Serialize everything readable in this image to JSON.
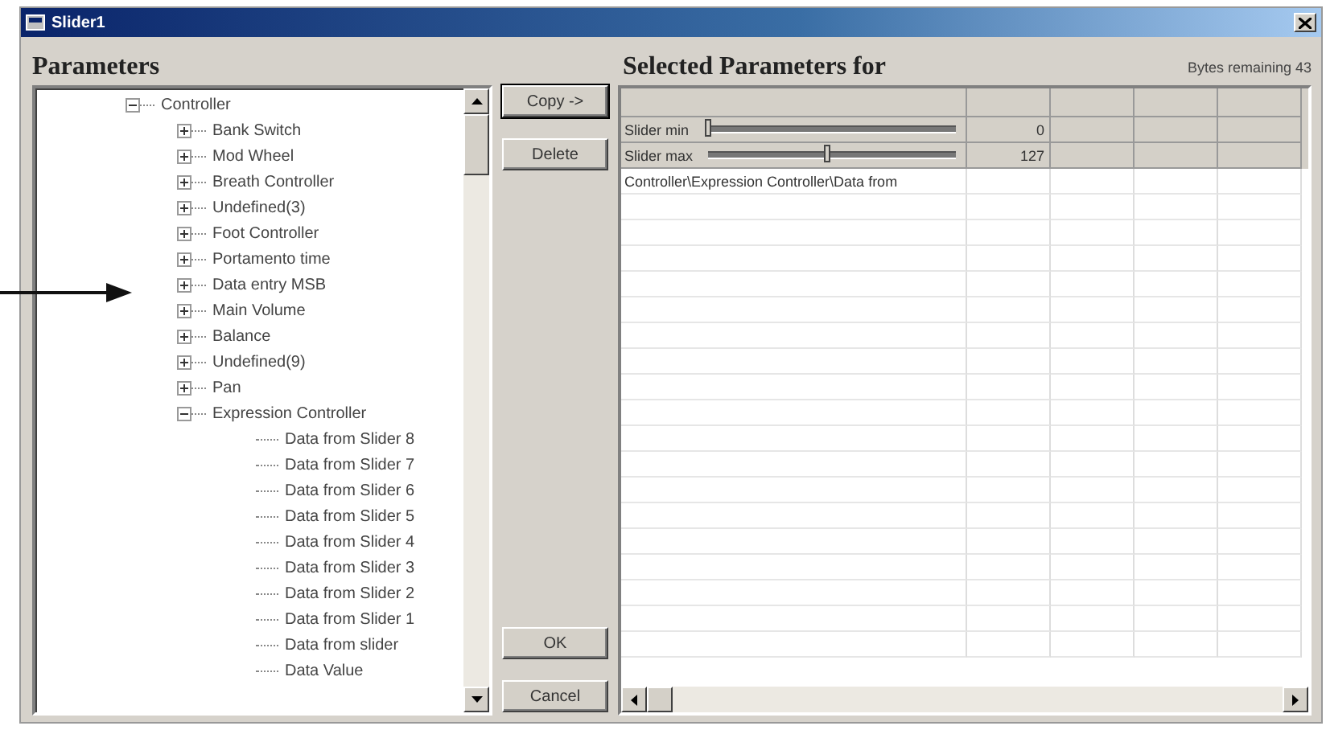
{
  "window": {
    "title": "Slider1"
  },
  "left_heading": "Parameters",
  "tree": [
    {
      "label": "Controller",
      "expanded": true,
      "children": [
        {
          "label": "Bank Switch",
          "expanded": false
        },
        {
          "label": "Mod Wheel",
          "expanded": false
        },
        {
          "label": "Breath Controller",
          "expanded": false
        },
        {
          "label": "Undefined(3)",
          "expanded": false
        },
        {
          "label": "Foot Controller",
          "expanded": false
        },
        {
          "label": "Portamento time",
          "expanded": false
        },
        {
          "label": "Data entry MSB",
          "expanded": false
        },
        {
          "label": "Main Volume",
          "expanded": false
        },
        {
          "label": "Balance",
          "expanded": false
        },
        {
          "label": "Undefined(9)",
          "expanded": false
        },
        {
          "label": "Pan",
          "expanded": false
        },
        {
          "label": "Expression Controller",
          "expanded": true,
          "children": [
            {
              "label": "Data from Slider 8"
            },
            {
              "label": "Data from Slider 7"
            },
            {
              "label": "Data from Slider 6"
            },
            {
              "label": "Data from Slider 5"
            },
            {
              "label": "Data from Slider 4"
            },
            {
              "label": "Data from Slider 3"
            },
            {
              "label": "Data from Slider 2"
            },
            {
              "label": "Data from Slider 1"
            },
            {
              "label": "Data from slider"
            },
            {
              "label": "Data Value"
            }
          ]
        }
      ]
    }
  ],
  "top_buttons": [
    {
      "label": "Copy ->",
      "default": true
    },
    {
      "label": "Delete",
      "default": false
    }
  ],
  "bottom_buttons": [
    {
      "label": "OK",
      "default": false
    },
    {
      "label": "Cancel",
      "default": false
    }
  ],
  "right_heading": "Selected Parameters for",
  "bytes_remaining": "Bytes remaining 43",
  "grid_rows": [
    {
      "kind": "slider",
      "label": "Slider min",
      "level": 0,
      "value": "0"
    },
    {
      "kind": "slider",
      "label": "Slider max",
      "level": 0.48,
      "value": "127"
    },
    {
      "kind": "text",
      "text": "Controller\\Expression Controller\\Data from"
    }
  ]
}
